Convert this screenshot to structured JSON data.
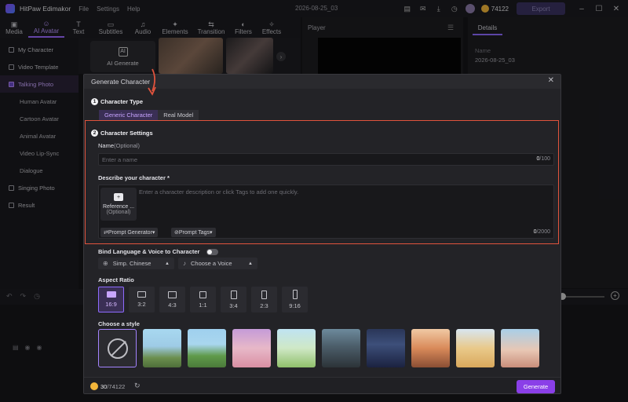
{
  "titlebar": {
    "app_title": "HitPaw Edimakor",
    "menu": [
      "File",
      "Settings",
      "Help"
    ],
    "project_name": "2026-08-25_03",
    "credits": "74122",
    "export_label": "Export"
  },
  "toolbar": {
    "tools": [
      {
        "label": "Media",
        "icon": "media-icon",
        "glyph": "▣"
      },
      {
        "label": "AI Avatar",
        "icon": "ai-avatar-icon",
        "glyph": "☺"
      },
      {
        "label": "Text",
        "icon": "text-icon",
        "glyph": "T"
      },
      {
        "label": "Subtitles",
        "icon": "subtitles-icon",
        "glyph": "▭"
      },
      {
        "label": "Audio",
        "icon": "audio-icon",
        "glyph": "♫"
      },
      {
        "label": "Elements",
        "icon": "elements-icon",
        "glyph": "✦"
      },
      {
        "label": "Transition",
        "icon": "transition-icon",
        "glyph": "⇆"
      },
      {
        "label": "Filters",
        "icon": "filters-icon",
        "glyph": "◐"
      },
      {
        "label": "Effects",
        "icon": "effects-icon",
        "glyph": "✧"
      }
    ],
    "active": "AI Avatar"
  },
  "sidebar": {
    "items": [
      {
        "label": "My Character"
      },
      {
        "label": "Video Template"
      },
      {
        "label": "Talking Photo"
      },
      {
        "label": "Human Avatar"
      },
      {
        "label": "Cartoon Avatar"
      },
      {
        "label": "Animal Avatar"
      },
      {
        "label": "Video Lip-Sync"
      },
      {
        "label": "Dialogue"
      },
      {
        "label": "Singing Photo"
      },
      {
        "label": "Result"
      }
    ]
  },
  "media": {
    "ai_generate_label": "AI Generate"
  },
  "player": {
    "title": "Player"
  },
  "details": {
    "tab_label": "Details",
    "name_label": "Name",
    "name_value": "2026-08-25_03"
  },
  "modal": {
    "title": "Generate Character",
    "step1": {
      "num": "1",
      "title": "Character Type",
      "options": [
        "Generic Character",
        "Real Model"
      ],
      "selected": "Generic Character"
    },
    "step2": {
      "num": "2",
      "title": "Character Settings",
      "name_label": "Name",
      "name_optional": "(Optional)",
      "name_placeholder": "Enter a name",
      "name_count": "0",
      "name_max": "/100",
      "describe_label": "Describe your character *",
      "reference_label": "Reference ...",
      "reference_sub": "(Optional)",
      "describe_placeholder": "Enter a character description or click Tags to add one quickly.",
      "prompt_generator": "Prompt Generator",
      "prompt_tags": "Prompt Tags",
      "describe_count": "0",
      "describe_max": "/2000"
    },
    "bind_label": "Bind Language & Voice to Character",
    "language_value": "Simp. Chinese",
    "voice_value": "Choose a Voice",
    "aspect_ratio_label": "Aspect Ratio",
    "aspect_ratios": [
      "16:9",
      "3:2",
      "4:3",
      "1:1",
      "3:4",
      "2:3",
      "9:16"
    ],
    "aspect_selected": "16:9",
    "style_label": "Choose a style",
    "footer_credits_used": "30",
    "footer_credits_total": "/74122",
    "generate_label": "Generate"
  },
  "colors": {
    "accent": "#8a3fe8",
    "accent_light": "#c8a5ff",
    "highlight_border": "#e0533d",
    "coin": "#f2b53a"
  }
}
